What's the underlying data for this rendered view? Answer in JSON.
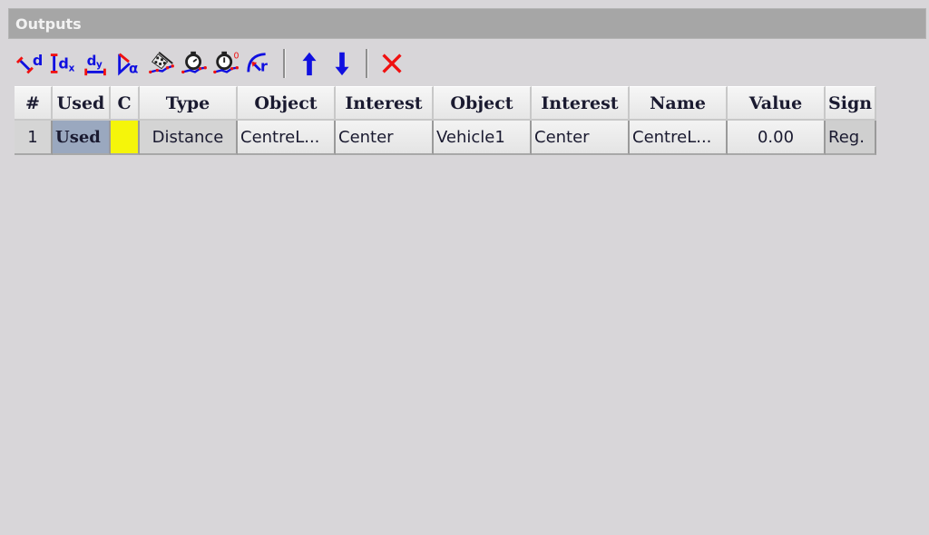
{
  "panel": {
    "title": "Outputs"
  },
  "toolbar": {
    "buttons": [
      {
        "name": "distance-icon",
        "label": "d"
      },
      {
        "name": "distance-x-icon",
        "label": "dx"
      },
      {
        "name": "distance-y-icon",
        "label": "dy"
      },
      {
        "name": "angle-icon",
        "label": "α"
      },
      {
        "name": "finish-flag-icon",
        "label": ""
      },
      {
        "name": "stopwatch-icon",
        "label": ""
      },
      {
        "name": "stopwatch-reset-icon",
        "label": "0"
      },
      {
        "name": "radius-icon",
        "label": "r"
      },
      {
        "name": "move-up-icon",
        "label": ""
      },
      {
        "name": "move-down-icon",
        "label": ""
      },
      {
        "name": "delete-icon",
        "label": ""
      }
    ]
  },
  "table": {
    "columns": [
      "#",
      "Used",
      "C",
      "Type",
      "Object",
      "Interest",
      "Object",
      "Interest",
      "Name",
      "Value",
      "Sign"
    ],
    "rows": [
      {
        "index": "1",
        "used": "Used",
        "color": "#f5f50a",
        "type": "Distance",
        "object1": "CentreL...",
        "interest1": "Center",
        "object2": "Vehicle1",
        "interest2": "Center",
        "name": "CentreL...",
        "value": "0.00",
        "sign": "Reg."
      }
    ]
  },
  "colors": {
    "icon_blue": "#1010e0",
    "icon_red": "#f01010",
    "header_bg": "#a6a6a6",
    "selected_cell": "#9aa8bf"
  }
}
